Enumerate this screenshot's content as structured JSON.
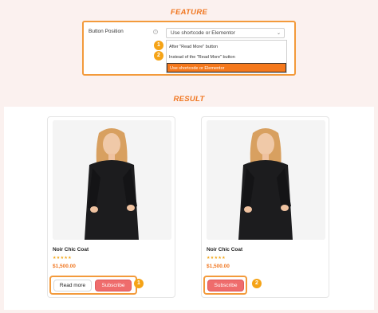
{
  "feature": {
    "heading": "FEATURE",
    "label": "Button Position",
    "help_icon": "help-icon",
    "selected": "Use shortcode or Elementor",
    "options": [
      "After \"Read More\" button",
      "Instead of the \"Read More\" button",
      "Use shortcode or Elementor"
    ],
    "markers": [
      "1",
      "2"
    ]
  },
  "result": {
    "heading": "RESULT",
    "cards": [
      {
        "name": "Noir Chic Coat",
        "stars": "★★★★★",
        "price": "$1,500.00",
        "read_more": "Read more",
        "subscribe": "Subscribe",
        "marker": "1"
      },
      {
        "name": "Noir Chic Coat",
        "stars": "★★★★★",
        "price": "$1,500.00",
        "subscribe": "Subscribe",
        "marker": "2"
      }
    ]
  },
  "colors": {
    "accent": "#f07620",
    "subscribe": "#ef6c6c",
    "highlight": "#f39a3b",
    "background": "#fbf1ef"
  }
}
